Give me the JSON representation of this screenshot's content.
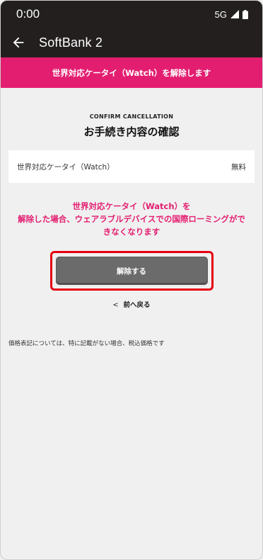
{
  "status": {
    "time": "0:00",
    "network": "5G"
  },
  "appbar": {
    "title": "SoftBank 2"
  },
  "banner": {
    "text": "世界対応ケータイ（Watch）を解除します"
  },
  "main": {
    "heading_en": "CONFIRM CANCELLATION",
    "heading_jp": "お手続き内容の確認",
    "service": {
      "name": "世界対応ケータイ（Watch）",
      "price": "無料"
    },
    "warning_line1": "世界対応ケータイ（Watch）を",
    "warning_line2": "解除した場合、ウェアラブルデバイスでの国際ローミングがで",
    "warning_line3": "きなくなります",
    "cancel_button": "解除する",
    "back_link": "前へ戻る",
    "note": "価格表記については、特に記載がない場合、税込価格です"
  },
  "colors": {
    "accent": "#e31e70",
    "header_bg": "#231f1f",
    "highlight": "#e60012",
    "button_bg": "#6b6b6b"
  },
  "icons": {
    "back": "arrow-left-icon",
    "signal": "signal-icon",
    "battery": "battery-icon"
  }
}
